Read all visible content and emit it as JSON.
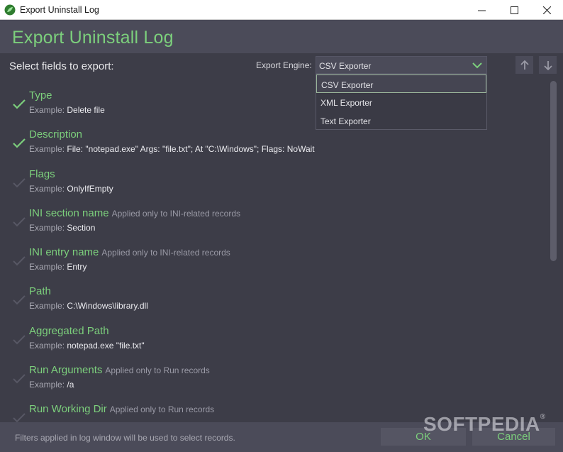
{
  "window": {
    "title": "Export Uninstall Log"
  },
  "header": {
    "heading": "Export Uninstall Log"
  },
  "toolbar": {
    "select_label": "Select fields to export:",
    "engine_label": "Export Engine:",
    "engine_value": "CSV Exporter",
    "engine_options": [
      "CSV Exporter",
      "XML Exporter",
      "Text Exporter"
    ]
  },
  "example_prefix": "Example:",
  "fields": [
    {
      "name": "Type",
      "note": "",
      "example": "Delete file",
      "checked": true
    },
    {
      "name": "Description",
      "note": "",
      "example": "File: \"notepad.exe\" Args: \"file.txt\"; At \"C:\\Windows\"; Flags: NoWait",
      "checked": true
    },
    {
      "name": "Flags",
      "note": "",
      "example": "OnlyIfEmpty",
      "checked": false
    },
    {
      "name": "INI section name",
      "note": "Applied only to INI-related records",
      "example": "Section",
      "checked": false
    },
    {
      "name": "INI entry name",
      "note": "Applied only to INI-related records",
      "example": "Entry",
      "checked": false
    },
    {
      "name": "Path",
      "note": "",
      "example": "C:\\Windows\\library.dll",
      "checked": false
    },
    {
      "name": "Aggregated Path",
      "note": "",
      "example": "notepad.exe \"file.txt\"",
      "checked": false
    },
    {
      "name": "Run Arguments",
      "note": "Applied only to Run records",
      "example": "/a",
      "checked": false
    },
    {
      "name": "Run Working Dir",
      "note": "Applied only to Run records",
      "example": "",
      "checked": false
    }
  ],
  "footer": {
    "hint": "Filters applied in log window will be used to select records.",
    "ok_label": "OK",
    "cancel_label": "Cancel"
  },
  "watermark": {
    "text": "SOFTPEDIA",
    "mark": "®"
  },
  "colors": {
    "accent": "#7ccf7c",
    "background": "#3d3d48",
    "panel": "#4b4b59"
  }
}
